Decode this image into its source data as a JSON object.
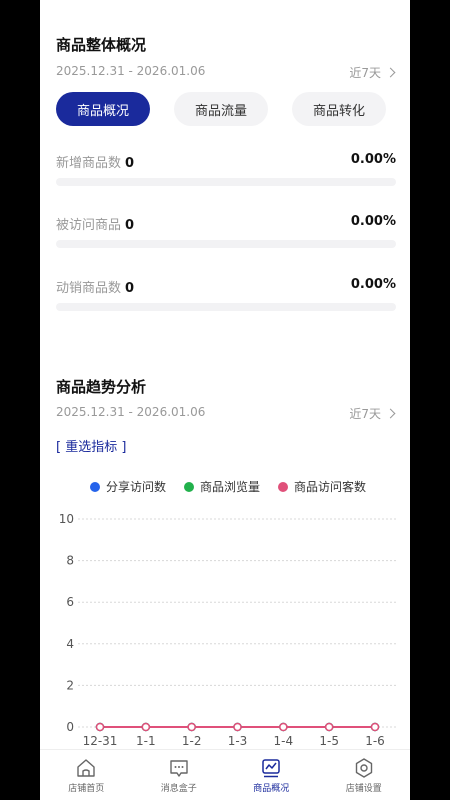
{
  "overview": {
    "title": "商品整体概况",
    "date_range": "2025.12.31 - 2026.01.06",
    "range_label": "近7天"
  },
  "tabs": [
    {
      "label": "商品概况",
      "active": true
    },
    {
      "label": "商品流量",
      "active": false
    },
    {
      "label": "商品转化",
      "active": false
    }
  ],
  "metrics": [
    {
      "label": "新增商品数",
      "value": "0",
      "percent": "0.00%",
      "progress": 0
    },
    {
      "label": "被访问商品",
      "value": "0",
      "percent": "0.00%",
      "progress": 0
    },
    {
      "label": "动销商品数",
      "value": "0",
      "percent": "0.00%",
      "progress": 0
    }
  ],
  "trend": {
    "title": "商品趋势分析",
    "date_range": "2025.12.31 - 2026.01.06",
    "range_label": "近7天",
    "reselect_label": "[ 重选指标 ]"
  },
  "colors": {
    "accent": "#1a2a9c",
    "series_share": "#2563eb",
    "series_views": "#22b14c",
    "series_visitors": "#e0507a"
  },
  "chart_data": {
    "type": "line",
    "categories": [
      "12-31",
      "1-1",
      "1-2",
      "1-3",
      "1-4",
      "1-5",
      "1-6"
    ],
    "ylim": [
      0,
      10
    ],
    "yticks": [
      "10",
      "8",
      "6",
      "4",
      "2",
      "0"
    ],
    "legend_position": "top",
    "grid": true,
    "series": [
      {
        "name": "分享访问数",
        "color": "#2563eb",
        "values": [
          0,
          0,
          0,
          0,
          0,
          0,
          0
        ]
      },
      {
        "name": "商品浏览量",
        "color": "#22b14c",
        "values": [
          0,
          0,
          0,
          0,
          0,
          0,
          0
        ]
      },
      {
        "name": "商品访问客数",
        "color": "#e0507a",
        "values": [
          0,
          0,
          0,
          0,
          0,
          0,
          0
        ]
      }
    ]
  },
  "tabbar": [
    {
      "label": "店铺首页",
      "icon": "home-icon",
      "active": false
    },
    {
      "label": "消息盒子",
      "icon": "message-icon",
      "active": false
    },
    {
      "label": "商品概况",
      "icon": "trend-icon",
      "active": true
    },
    {
      "label": "店铺设置",
      "icon": "settings-icon",
      "active": false
    }
  ]
}
